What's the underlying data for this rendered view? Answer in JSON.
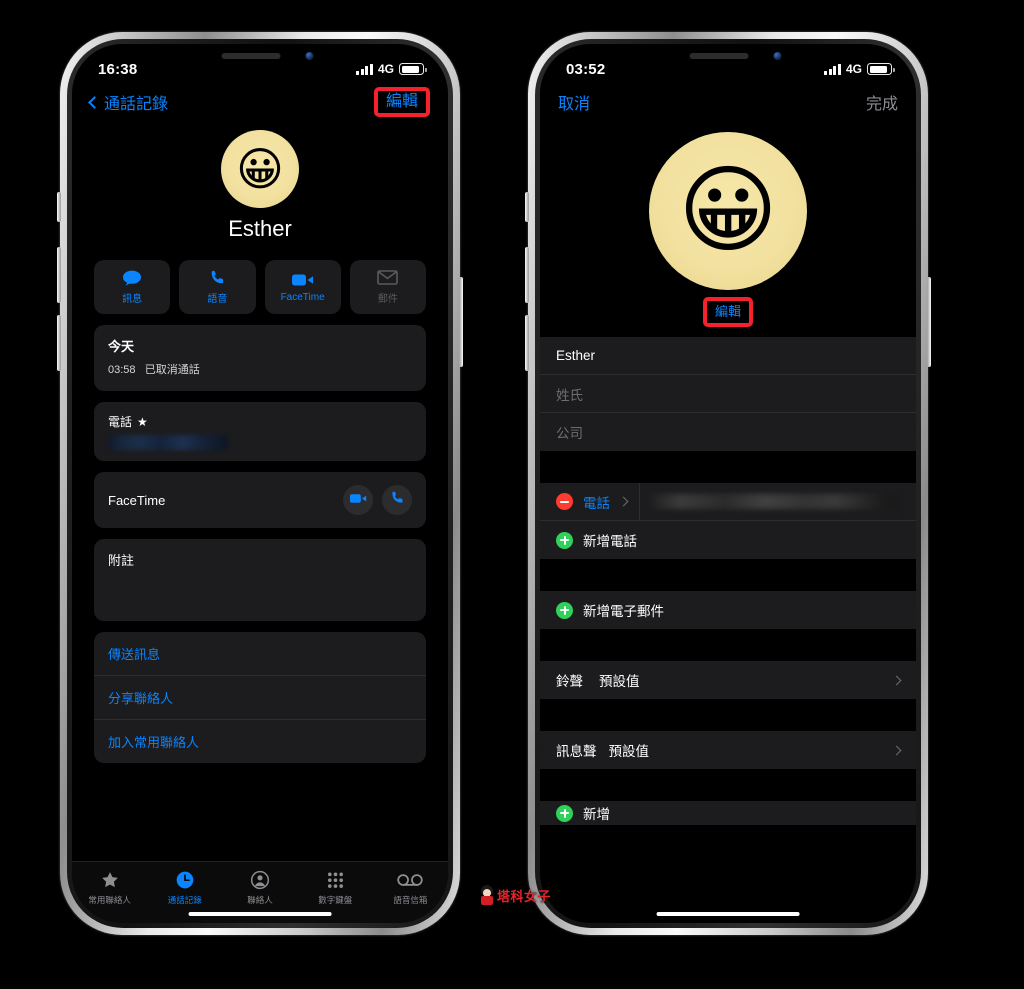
{
  "left_phone": {
    "status": {
      "time": "16:38",
      "network": "4G",
      "signal_bars": 4,
      "battery_level": 85
    },
    "nav": {
      "back_label": "通話記錄",
      "action_label": "編輯",
      "action_highlighted": true
    },
    "contact": {
      "name": "Esther",
      "avatar_emoji": "😀"
    },
    "actions": [
      {
        "label": "訊息",
        "icon": "message-icon",
        "enabled": true
      },
      {
        "label": "語音",
        "icon": "phone-icon",
        "enabled": true
      },
      {
        "label": "FaceTime",
        "icon": "video-icon",
        "enabled": true
      },
      {
        "label": "郵件",
        "icon": "mail-icon",
        "enabled": false
      }
    ],
    "call_history": {
      "day": "今天",
      "time": "03:58",
      "status": "已取消通話"
    },
    "phone_card": {
      "label": "電話",
      "favorite_star": "★",
      "number_redacted": true
    },
    "facetime_card": {
      "label": "FaceTime",
      "video_icon": "video-icon",
      "audio_icon": "phone-icon"
    },
    "notes_card": {
      "label": "附註",
      "value": ""
    },
    "links": [
      "傳送訊息",
      "分享聯絡人",
      "加入常用聯絡人"
    ],
    "tabs": [
      {
        "label": "常用聯絡人",
        "icon": "star-icon",
        "active": false
      },
      {
        "label": "通話記錄",
        "icon": "clock-icon",
        "active": true
      },
      {
        "label": "聯絡人",
        "icon": "person-circle-icon",
        "active": false
      },
      {
        "label": "數字鍵盤",
        "icon": "keypad-icon",
        "active": false
      },
      {
        "label": "語音信箱",
        "icon": "voicemail-icon",
        "active": false
      }
    ]
  },
  "right_phone": {
    "status": {
      "time": "03:52",
      "network": "4G",
      "signal_bars": 4,
      "battery_level": 85
    },
    "nav": {
      "cancel_label": "取消",
      "done_label": "完成",
      "done_enabled": false
    },
    "contact": {
      "avatar_emoji": "😀",
      "edit_photo_label": "編輯",
      "edit_highlighted": true
    },
    "name_fields": [
      {
        "value": "Esther",
        "is_placeholder": false
      },
      {
        "value": "姓氏",
        "is_placeholder": true
      },
      {
        "value": "公司",
        "is_placeholder": true
      }
    ],
    "phone_section": [
      {
        "icon": "minus-circle-icon",
        "label": "電話",
        "has_chevron": true,
        "value_redacted": true
      },
      {
        "icon": "plus-circle-icon",
        "label": "新增電話"
      }
    ],
    "email_section": [
      {
        "icon": "plus-circle-icon",
        "label": "新增電子郵件"
      }
    ],
    "ringtone_row": {
      "label": "鈴聲",
      "value": "預設值",
      "has_chevron": true
    },
    "texttone_row": {
      "label": "訊息聲",
      "value": "預設值",
      "has_chevron": true
    },
    "partial_bottom_row": {
      "icon": "plus-circle-icon",
      "label": "新增"
    }
  },
  "watermark": {
    "text": "塔科女子"
  },
  "colors": {
    "accent_blue": "#0a84ff",
    "highlight_red": "#f5212d",
    "green": "#30d158",
    "red": "#ff3b30",
    "card_bg": "#1c1c1e"
  }
}
